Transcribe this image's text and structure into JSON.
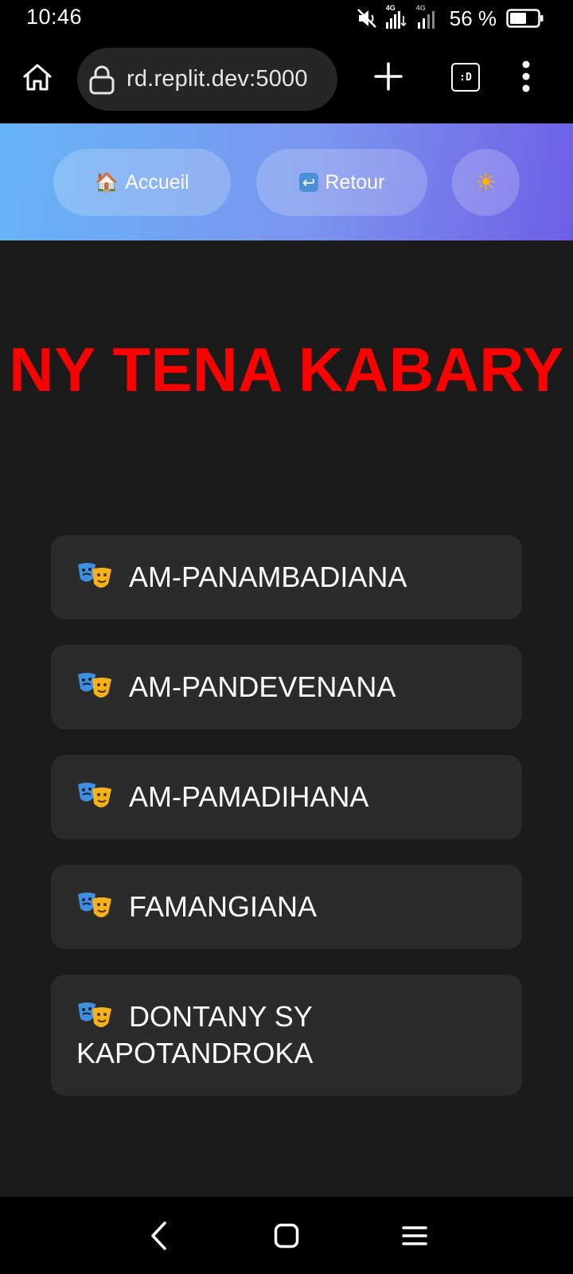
{
  "status_bar": {
    "time": "10:46",
    "network_tag_1": "4G",
    "network_tag_2": "4G",
    "battery_percent": "56 %",
    "icons": [
      "mute-icon",
      "signal-icon",
      "signal-icon",
      "battery-icon"
    ]
  },
  "browser": {
    "url": "rd.replit.dev:5000",
    "tab_counter": ":D",
    "icons": [
      "home-icon",
      "lock-icon",
      "plus-icon",
      "tabs-icon",
      "more-vert-icon"
    ]
  },
  "nav": {
    "home_emoji": "🏠",
    "home_label": "Accueil",
    "back_emoji": "↩",
    "back_label": "Retour",
    "theme_emoji": "☀"
  },
  "page": {
    "title": "NY TENA KABARY"
  },
  "categories": [
    {
      "label": "AM-PANAMBADIANA",
      "icon": "theater-masks-icon"
    },
    {
      "label": "AM-PANDEVENANA",
      "icon": "theater-masks-icon"
    },
    {
      "label": "AM-PAMADIHANA",
      "icon": "theater-masks-icon"
    },
    {
      "label": "FAMANGIANA",
      "icon": "theater-masks-icon"
    },
    {
      "label": "DONTANY SY KAPOTANDROKA",
      "icon": "theater-masks-icon"
    }
  ],
  "colors": {
    "title_red": "#ff0000",
    "page_bg": "#1b1b1b",
    "card_bg": "#2b2b2b",
    "nav_gradient_start": "#66b5f6",
    "nav_gradient_end": "#6e5ee6"
  },
  "android_nav": {
    "icons": [
      "back-icon",
      "home-icon",
      "recents-icon"
    ]
  }
}
